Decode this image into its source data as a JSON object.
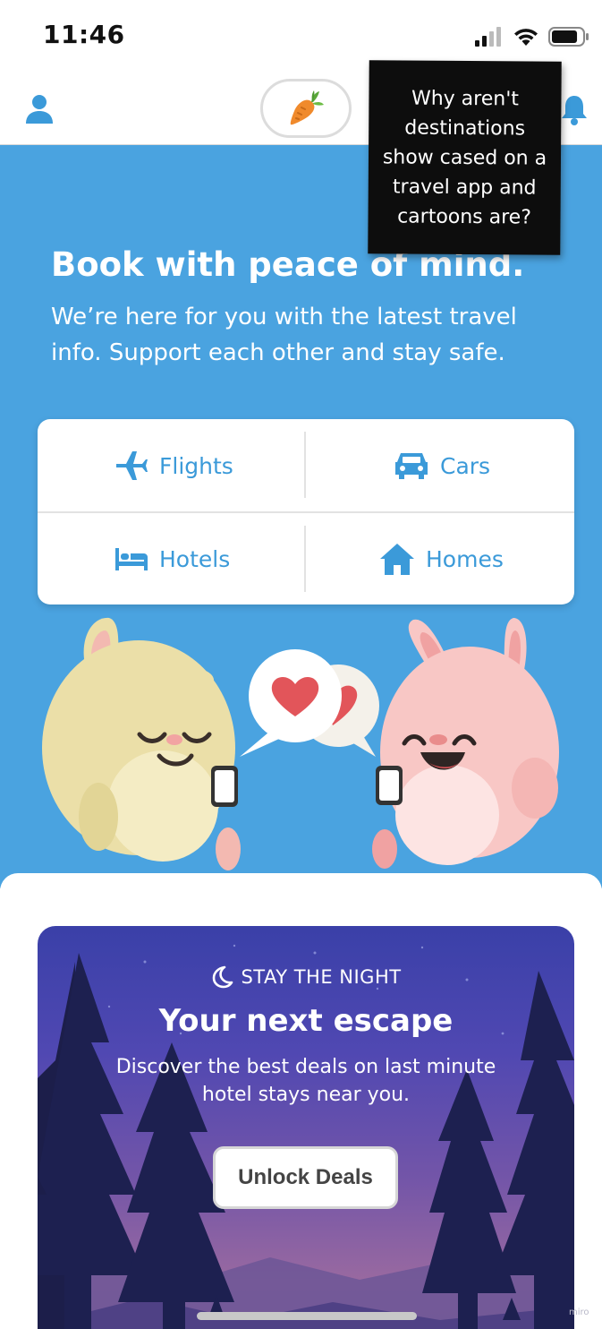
{
  "status_bar": {
    "time": "11:46",
    "battery_level": 0.85
  },
  "header": {
    "profile_icon": "person-icon",
    "center_button_icon": "carrot-icon",
    "notifications_icon": "bell-icon"
  },
  "hero": {
    "title": "Book with peace of mind.",
    "subtitle": "We’re here for you with the latest travel info. Support each other and stay safe."
  },
  "booking_options": [
    {
      "label": "Flights",
      "icon": "airplane-icon"
    },
    {
      "label": "Cars",
      "icon": "car-icon"
    },
    {
      "label": "Hotels",
      "icon": "bed-icon"
    },
    {
      "label": "Homes",
      "icon": "house-icon"
    }
  ],
  "promo": {
    "eyebrow": "STAY THE NIGHT",
    "eyebrow_icon": "moon-icon",
    "title": "Your next escape",
    "description": "Discover the best deals on last minute hotel stays near you.",
    "button_label": "Unlock Deals"
  },
  "sticky_note": {
    "text": "Why aren't destinations show cased on a travel app and cartoons are?"
  },
  "watermark": "miro",
  "colors": {
    "hero_blue": "#4aa3e0",
    "accent_blue": "#3b9ad9",
    "promo_purple": "#4a44b0"
  }
}
